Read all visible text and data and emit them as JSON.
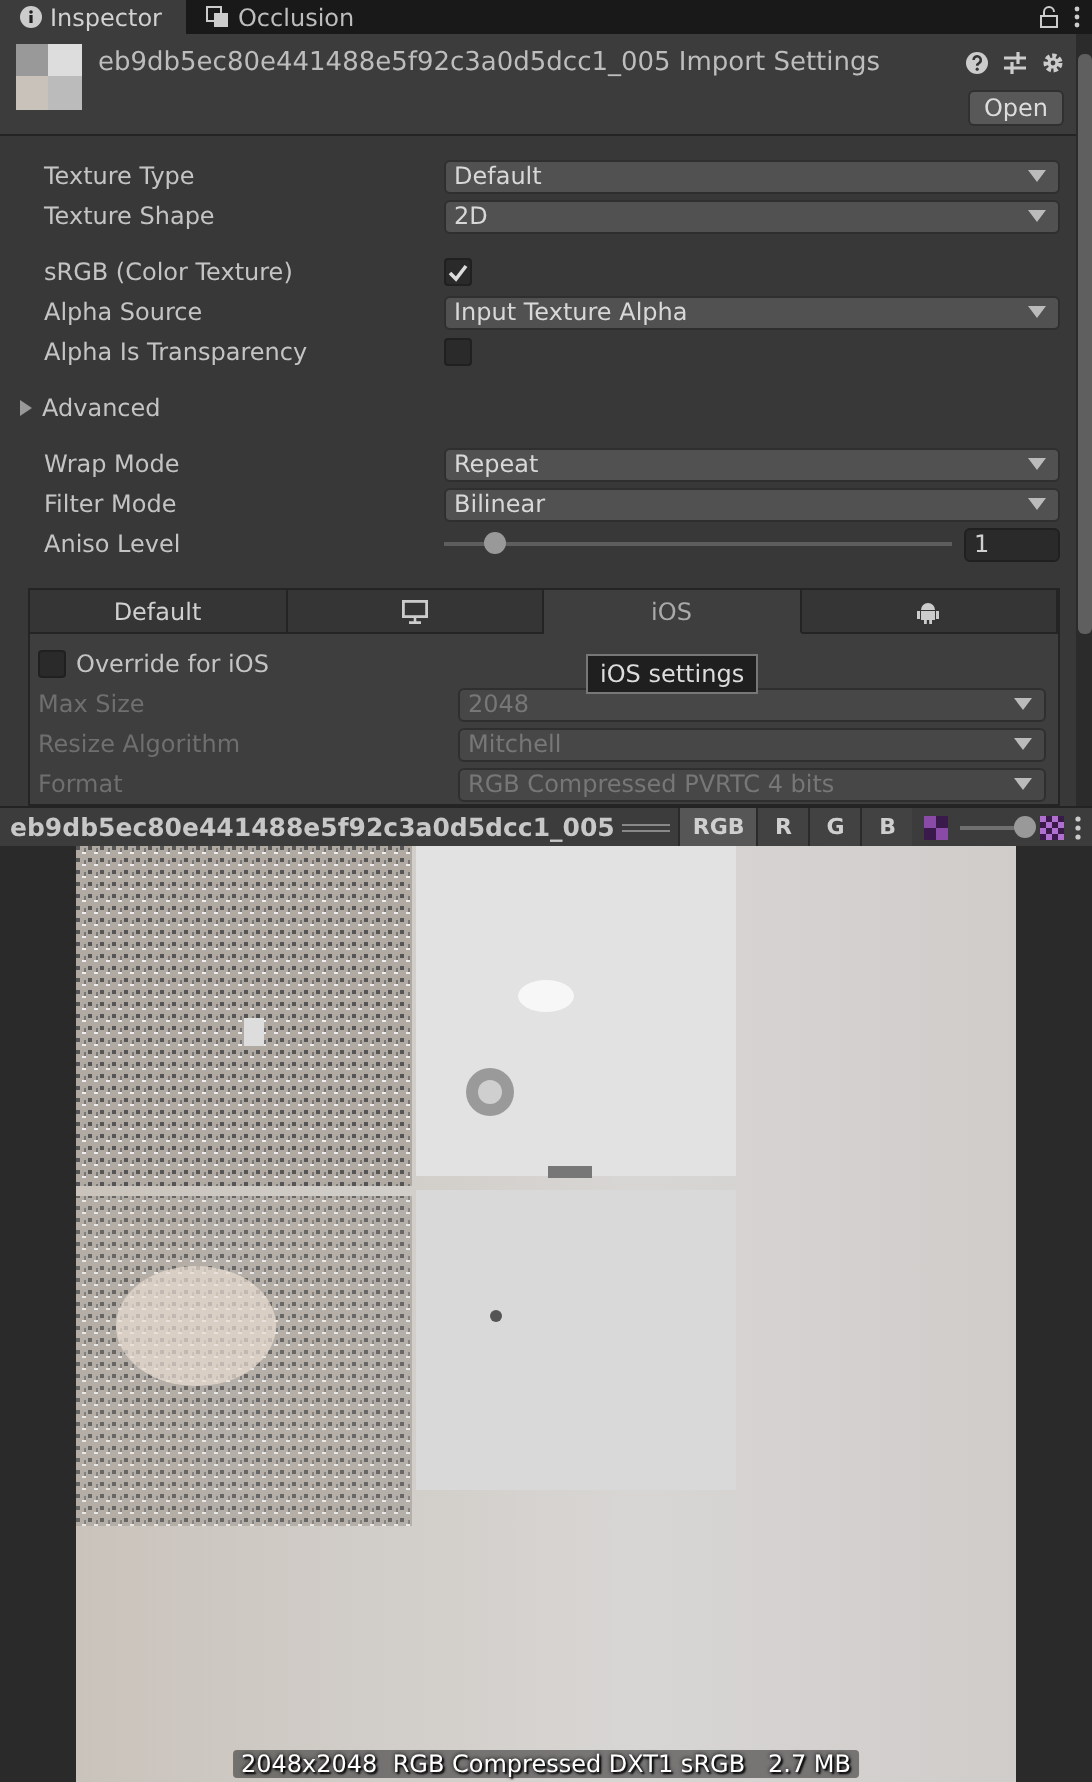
{
  "window_tabs": [
    {
      "label": "Inspector",
      "kind": "info",
      "selected": true
    },
    {
      "label": "Occlusion",
      "kind": "occlusion",
      "selected": false
    }
  ],
  "header": {
    "title": "eb9db5ec80e441488e5f92c3a0d5dcc1_005 Import Settings",
    "open_button": "Open"
  },
  "groups": [
    [
      {
        "kind": "dropdown",
        "label": "Texture Type",
        "value": "Default"
      },
      {
        "kind": "dropdown",
        "label": "Texture Shape",
        "value": "2D"
      }
    ],
    [
      {
        "kind": "checkbox",
        "label": "sRGB (Color Texture)",
        "checked": true
      },
      {
        "kind": "dropdown",
        "label": "Alpha Source",
        "value": "Input Texture Alpha"
      },
      {
        "kind": "checkbox",
        "label": "Alpha Is Transparency",
        "checked": false
      }
    ],
    [
      {
        "kind": "foldout",
        "label": "Advanced",
        "expanded": false
      }
    ],
    [
      {
        "kind": "dropdown",
        "label": "Wrap Mode",
        "value": "Repeat"
      },
      {
        "kind": "dropdown",
        "label": "Filter Mode",
        "value": "Bilinear"
      },
      {
        "kind": "slider",
        "label": "Aniso Level",
        "level": 0.1,
        "value": "1"
      }
    ]
  ],
  "platform_tabs": [
    {
      "kind": "text",
      "label": "Default",
      "selected": false
    },
    {
      "kind": "monitor",
      "selected": false
    },
    {
      "kind": "text",
      "label": "iOS",
      "selected": true
    },
    {
      "kind": "android",
      "selected": false
    }
  ],
  "override": {
    "label": "Override for iOS",
    "checked": false
  },
  "tooltip": "iOS settings",
  "platform_fields": [
    {
      "label": "Max Size",
      "value": "2048",
      "disabled": true
    },
    {
      "label": "Resize Algorithm",
      "value": "Mitchell",
      "disabled": true
    },
    {
      "label": "Format",
      "value": "RGB Compressed PVRTC 4 bits",
      "disabled": true
    }
  ],
  "preview": {
    "name": "eb9db5ec80e441488e5f92c3a0d5dcc1_005",
    "channels": [
      {
        "label": "RGB",
        "selected": true
      },
      {
        "label": "R",
        "selected": false
      },
      {
        "label": "G",
        "selected": false
      },
      {
        "label": "B",
        "selected": false
      }
    ],
    "mip_slider": {
      "level": 0.95
    },
    "info": "2048x2048  RGB Compressed DXT1 sRGB   2.7 MB"
  }
}
